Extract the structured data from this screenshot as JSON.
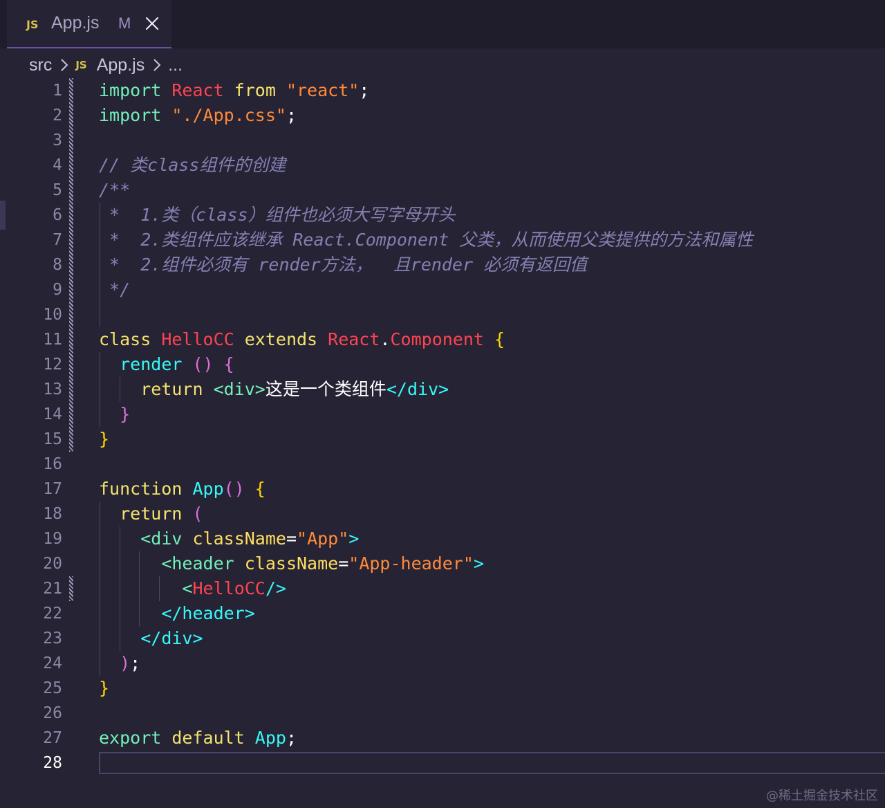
{
  "tab": {
    "js_badge": "JS",
    "file_name": "App.js",
    "status": "M"
  },
  "breadcrumb": {
    "folder": "src",
    "js_badge": "JS",
    "file": "App.js",
    "more": "..."
  },
  "editor": {
    "active_line": 28,
    "line_numbers": [
      "1",
      "2",
      "3",
      "4",
      "5",
      "6",
      "7",
      "8",
      "9",
      "10",
      "11",
      "12",
      "13",
      "14",
      "15",
      "16",
      "17",
      "18",
      "19",
      "20",
      "21",
      "22",
      "23",
      "24",
      "25",
      "26",
      "27",
      "28"
    ],
    "lines": [
      [
        [
          "import ",
          "imp"
        ],
        [
          "React ",
          "cls"
        ],
        [
          "from ",
          "kw"
        ],
        [
          "\"react\"",
          "str"
        ],
        [
          ";",
          "txt"
        ]
      ],
      [
        [
          "import ",
          "imp"
        ],
        [
          "\"./App.css\"",
          "str"
        ],
        [
          ";",
          "txt"
        ]
      ],
      [],
      [
        [
          "// 类class组件的创建",
          "cm"
        ]
      ],
      [
        [
          "/**",
          "cm"
        ]
      ],
      [
        [
          " *  1.类（class）组件也必须大写字母开头",
          "cm"
        ]
      ],
      [
        [
          " *  2.类组件应该继承 React.Component 父类，从而使用父类提供的方法和属性",
          "cm"
        ]
      ],
      [
        [
          " *  2.组件必须有 render方法，  且render 必须有返回值",
          "cm"
        ]
      ],
      [
        [
          " */",
          "cm"
        ]
      ],
      [],
      [
        [
          "class ",
          "kw"
        ],
        [
          "HelloCC ",
          "cls"
        ],
        [
          "extends ",
          "kw"
        ],
        [
          "React",
          "cls"
        ],
        [
          ".",
          "txt"
        ],
        [
          "Component ",
          "cls"
        ],
        [
          "{",
          "br1"
        ]
      ],
      [
        [
          "  ",
          "txt"
        ],
        [
          "render ",
          "fn"
        ],
        [
          "() ",
          "br2"
        ],
        [
          "{",
          "br2"
        ]
      ],
      [
        [
          "    ",
          "txt"
        ],
        [
          "return ",
          "kw"
        ],
        [
          "<div>",
          "tag"
        ],
        [
          "这是一个类组件",
          "txt"
        ],
        [
          "</div>",
          "tagb"
        ]
      ],
      [
        [
          "  ",
          "txt"
        ],
        [
          "}",
          "br2"
        ]
      ],
      [
        [
          "}",
          "br1"
        ]
      ],
      [],
      [
        [
          "function ",
          "kw"
        ],
        [
          "App",
          "fn"
        ],
        [
          "() ",
          "br2"
        ],
        [
          "{",
          "br1"
        ]
      ],
      [
        [
          "  ",
          "txt"
        ],
        [
          "return ",
          "kw"
        ],
        [
          "(",
          "br2"
        ]
      ],
      [
        [
          "    ",
          "txt"
        ],
        [
          "<div ",
          "tag"
        ],
        [
          "className",
          "attr"
        ],
        [
          "=",
          "txt"
        ],
        [
          "\"App\"",
          "str"
        ],
        [
          ">",
          "tagb"
        ]
      ],
      [
        [
          "      ",
          "txt"
        ],
        [
          "<header ",
          "tag"
        ],
        [
          "className",
          "attr"
        ],
        [
          "=",
          "txt"
        ],
        [
          "\"App-header\"",
          "str"
        ],
        [
          ">",
          "tagb"
        ]
      ],
      [
        [
          "        ",
          "txt"
        ],
        [
          "<",
          "tag"
        ],
        [
          "HelloCC",
          "cls"
        ],
        [
          "/>",
          "tagb"
        ]
      ],
      [
        [
          "      ",
          "txt"
        ],
        [
          "</header>",
          "tagb"
        ]
      ],
      [
        [
          "    ",
          "txt"
        ],
        [
          "</div>",
          "tagb"
        ]
      ],
      [
        [
          "  ",
          "txt"
        ],
        [
          ")",
          "br2"
        ],
        [
          ";",
          "txt"
        ]
      ],
      [
        [
          "}",
          "br1"
        ]
      ],
      [],
      [
        [
          "export ",
          "imp"
        ],
        [
          "default ",
          "kw"
        ],
        [
          "App",
          "fn"
        ],
        [
          ";",
          "txt"
        ]
      ],
      []
    ]
  },
  "watermark": "@稀土掘金技术社区"
}
